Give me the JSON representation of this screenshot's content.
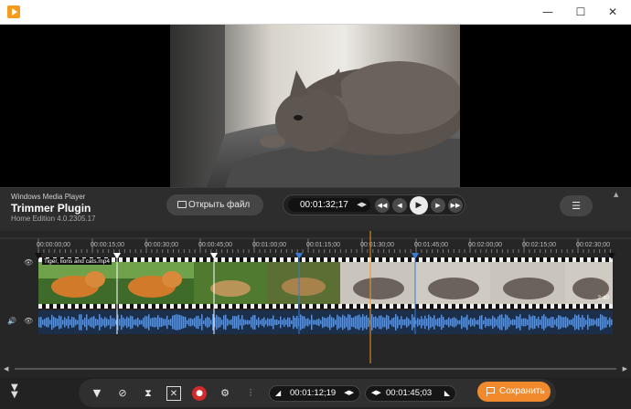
{
  "window": {
    "icon": "play-logo-icon",
    "minimize_glyph": "—",
    "maximize_glyph": "☐",
    "close_glyph": "✕"
  },
  "brand": {
    "line1": "Windows Media Player",
    "line2": "Trimmer Plugin",
    "line3": "Home Edition 4.0.2305.17"
  },
  "toolbar": {
    "open_label": "Открыть файл",
    "current_time": "00:01:32;17",
    "menu_glyph": "☰",
    "collapse_glyph": "▲",
    "accent": "#f39a1f"
  },
  "timeline": {
    "ticks": [
      "00:00:00;00",
      "00:00:15;00",
      "00:00:30;00",
      "00:00:45;00",
      "00:01:00;00",
      "00:01:15;00",
      "00:01:30;00",
      "00:01:45;00",
      "00:02:00;00",
      "00:02:15;00",
      "00:02:30;00"
    ],
    "clip_name": "Tiger, lions and cats.mp4",
    "clip_duration": "2:40",
    "audio_color": "#5b8fd6",
    "playhead_color": "#f39a1f"
  },
  "bottom": {
    "start_time": "00:01:12;19",
    "end_time": "00:01:45;03",
    "save_label": "Сохранить",
    "save_color": "#f08a2c"
  }
}
